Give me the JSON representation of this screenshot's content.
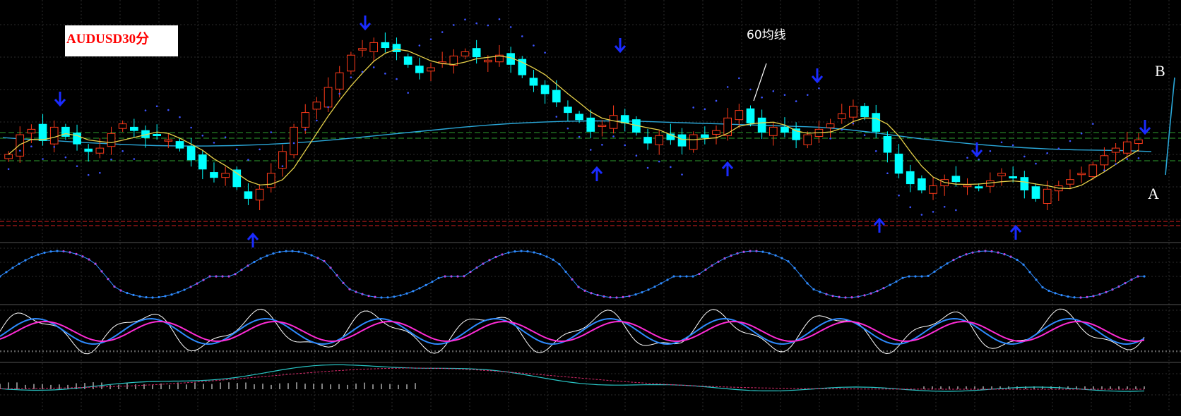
{
  "symbol_label": "AUDUSD30分",
  "ma60_annotation": "60均线",
  "point_b": "B",
  "point_a": "A",
  "colors": {
    "bull": "#ff3a1a",
    "bear": "#00ffff",
    "ma_fast": "#e8d24a",
    "ma60": "#2aa7d8",
    "sar": "#3d53ff",
    "arrow": "#1a2bff",
    "green_line": "#2e9e2e",
    "red_line": "#d62020",
    "magenta": "#ff2bd6",
    "blue_line": "#2e8bff",
    "grid": "#2b2b2b"
  },
  "icons": {
    "up": "up-arrow-icon",
    "down": "down-arrow-icon"
  },
  "chart_data": {
    "type": "candlestick",
    "title": "AUDUSD30分",
    "series": [
      {
        "name": "close",
        "values": [
          1.0345,
          1.0392,
          1.0405,
          1.0378,
          1.041,
          1.0388,
          1.037,
          1.0352,
          1.036,
          1.0395,
          1.0418,
          1.0402,
          1.0385,
          1.0392,
          1.038,
          1.036,
          1.0332,
          1.031,
          1.029,
          1.03,
          1.0268,
          1.024,
          1.0262,
          1.03,
          1.0352,
          1.041,
          1.0445,
          1.047,
          1.0505,
          1.054,
          1.0582,
          1.0598,
          1.0612,
          1.06,
          1.059,
          1.056,
          1.054,
          1.0552,
          1.0566,
          1.058,
          1.059,
          1.0578,
          1.057,
          1.0582,
          1.056,
          1.0535,
          1.051,
          1.049,
          1.047,
          1.0445,
          1.0428,
          1.04,
          1.0415,
          1.0438,
          1.042,
          1.0398,
          1.0372,
          1.039,
          1.038,
          1.0365,
          1.0392,
          1.0385,
          1.0402,
          1.0432,
          1.045,
          1.042,
          1.0398,
          1.041,
          1.0398,
          1.038,
          1.0392,
          1.0405,
          1.0418,
          1.0442,
          1.046,
          1.0435,
          1.04,
          1.035,
          1.03,
          1.0275,
          1.026,
          1.027,
          1.0285,
          1.028,
          1.0272,
          1.0265,
          1.0282,
          1.03,
          1.029,
          1.026,
          1.024,
          1.0262,
          1.027,
          1.0285,
          1.03,
          1.032,
          1.0342,
          1.036,
          1.0375,
          1.038
        ]
      },
      {
        "name": "60均线",
        "values": [
          1.0385,
          1.0381,
          1.0378,
          1.0374,
          1.0371,
          1.0368,
          1.0366,
          1.0365,
          1.0365,
          1.0366,
          1.0368,
          1.0371,
          1.0375,
          1.038,
          1.0386,
          1.0392,
          1.0398,
          1.0404,
          1.041,
          1.0415,
          1.0419,
          1.0422,
          1.0424,
          1.0425,
          1.0425,
          1.0424,
          1.0422,
          1.042,
          1.0418,
          1.0416,
          1.0414,
          1.0412,
          1.041,
          1.0405,
          1.0398,
          1.039,
          1.0382,
          1.0376,
          1.037,
          1.0365,
          1.0361,
          1.0358,
          1.0356,
          1.0355,
          1.0354,
          1.0352
        ]
      }
    ],
    "indicators": [
      "Parabolic SAR",
      "signal oscillator",
      "stochastic",
      "MACD"
    ]
  }
}
